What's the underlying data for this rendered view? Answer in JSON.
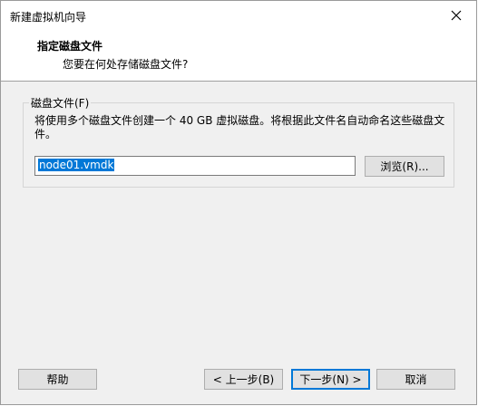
{
  "window": {
    "title": "新建虚拟机向导",
    "close_icon": "close-icon"
  },
  "header": {
    "title": "指定磁盘文件",
    "subtitle": "您要在何处存储磁盘文件?"
  },
  "disk_file_group": {
    "legend": "磁盘文件(F)",
    "description": "将使用多个磁盘文件创建一个 40 GB 虚拟磁盘。将根据此文件名自动命名这些磁盘文件。",
    "file_name_value": "node01.vmdk",
    "browse_label": "浏览(R)..."
  },
  "footer": {
    "help_label": "帮助",
    "back_label": "< 上一步(B)",
    "next_label": "下一步(N) >",
    "cancel_label": "取消"
  },
  "colors": {
    "selection": "#0078d7",
    "dialog_bg": "#f0f0f0"
  }
}
